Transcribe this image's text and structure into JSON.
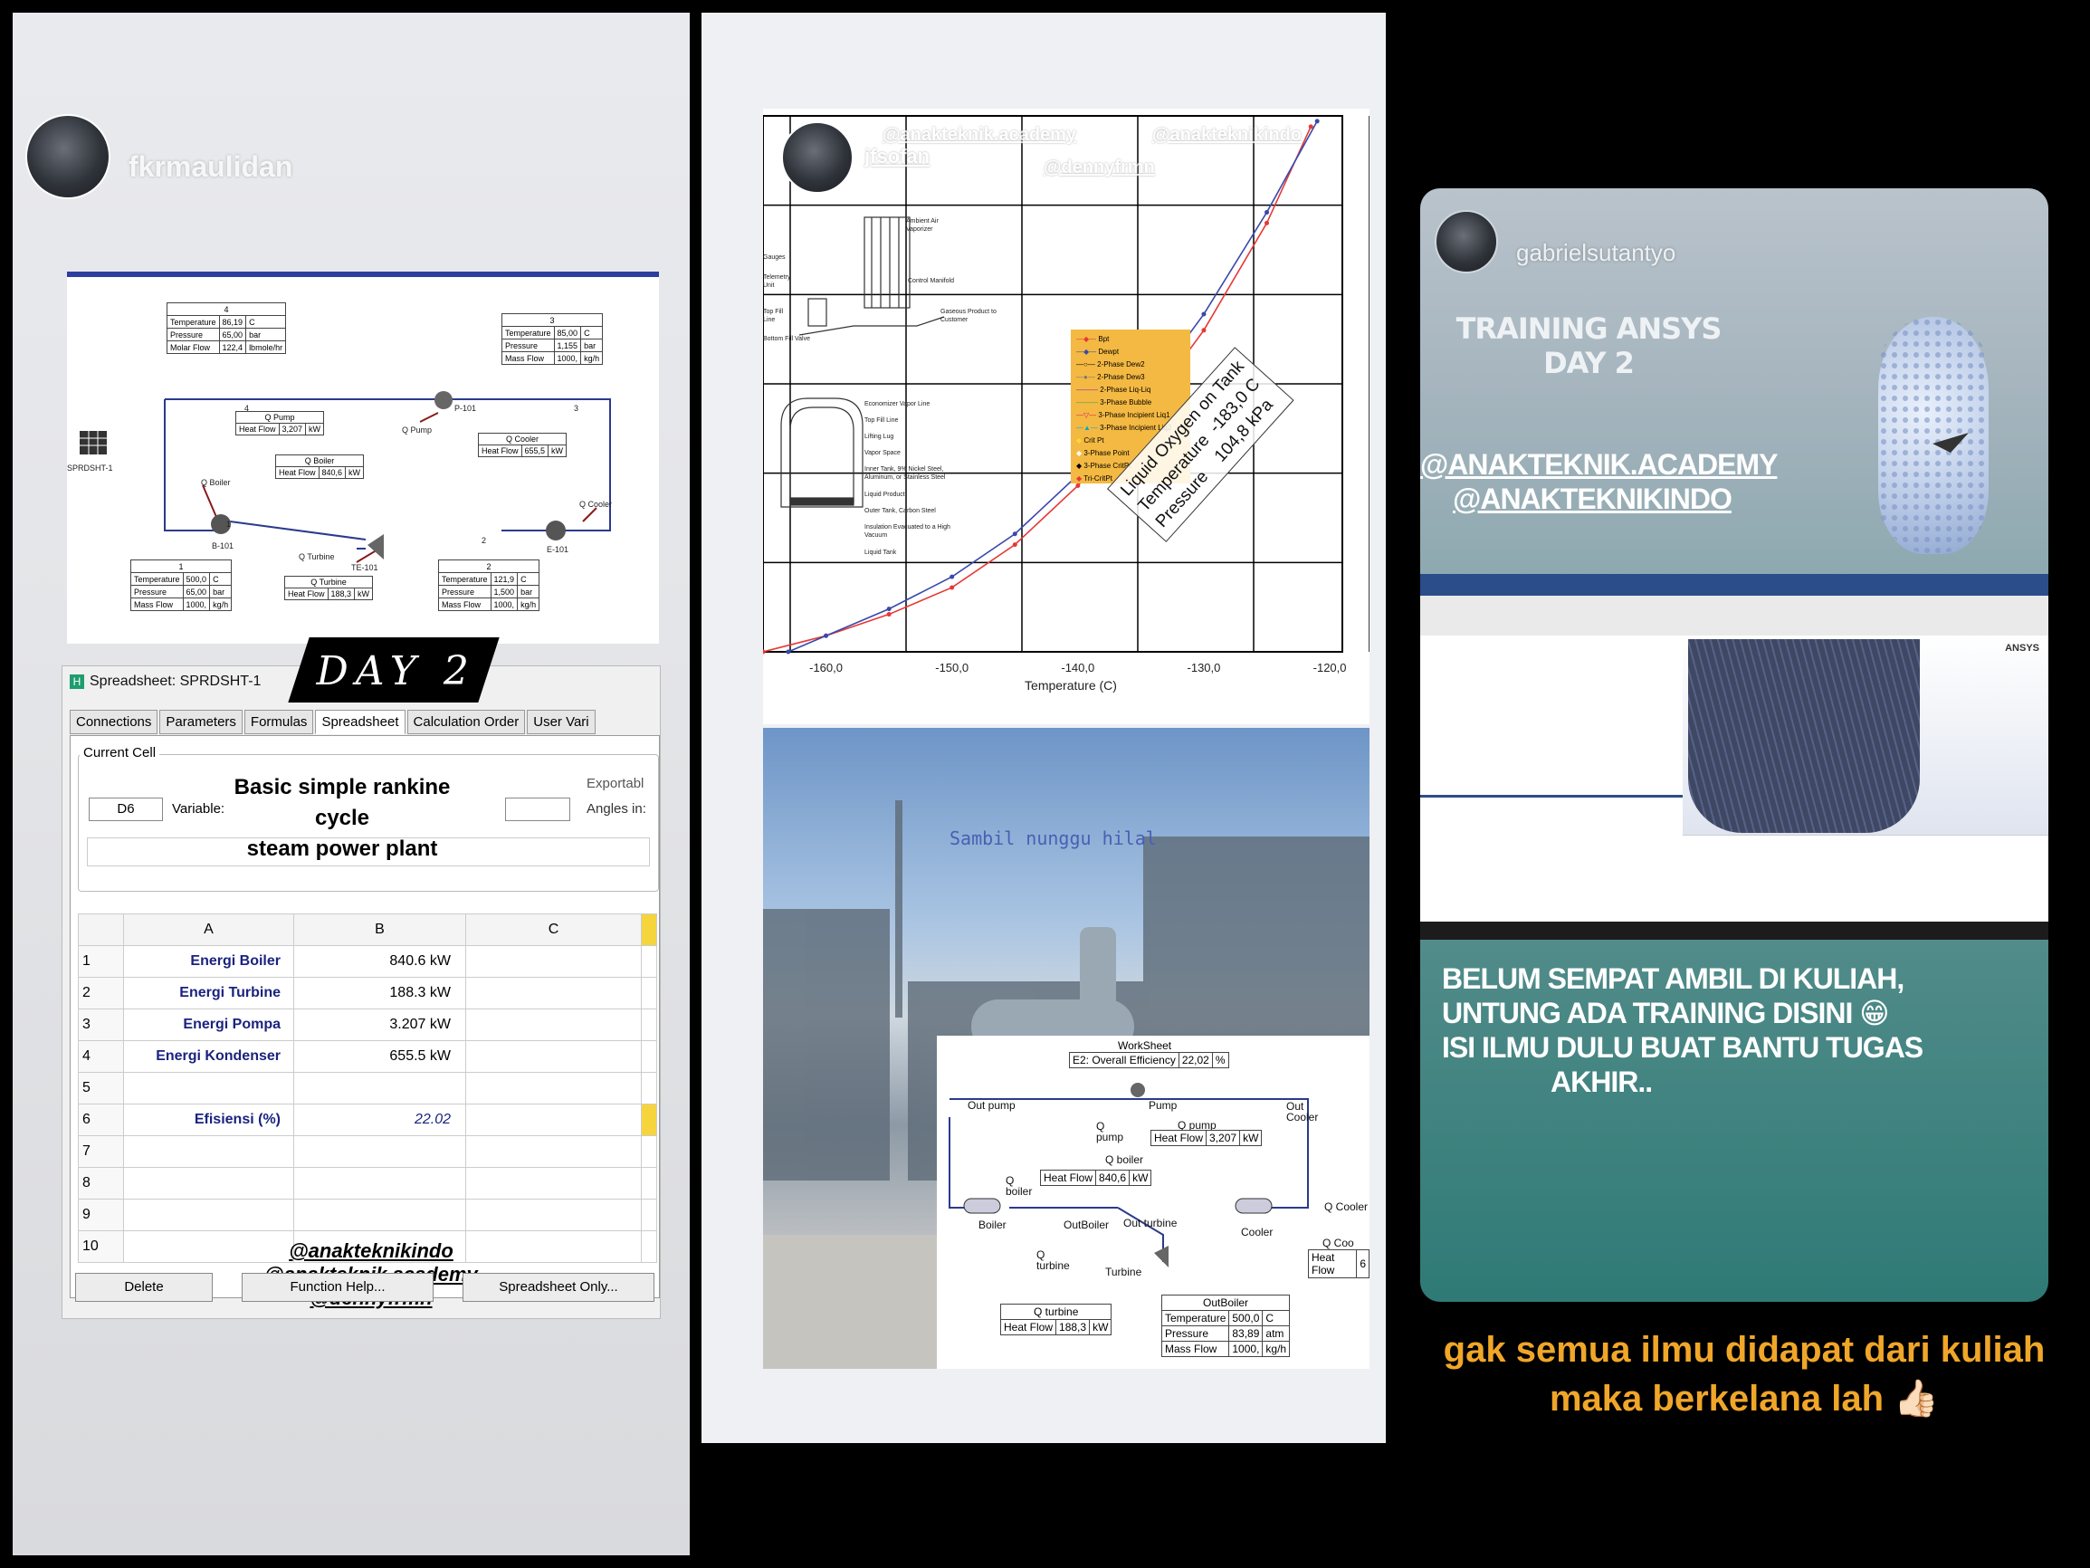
{
  "story1": {
    "username": "fkrmaulidan",
    "diagram": {
      "stream4": {
        "id": "4",
        "rows": [
          [
            "Temperature",
            "86,19",
            "C"
          ],
          [
            "Pressure",
            "65,00",
            "bar"
          ],
          [
            "Molar Flow",
            "122,4",
            "lbmole/hr"
          ]
        ]
      },
      "stream3": {
        "id": "3",
        "rows": [
          [
            "Temperature",
            "85,00",
            "C"
          ],
          [
            "Pressure",
            "1,155",
            "bar"
          ],
          [
            "Mass Flow",
            "1000,",
            "kg/h"
          ]
        ]
      },
      "stream1": {
        "id": "1",
        "rows": [
          [
            "Temperature",
            "500,0",
            "C"
          ],
          [
            "Pressure",
            "65,00",
            "bar"
          ],
          [
            "Mass Flow",
            "1000,",
            "kg/h"
          ]
        ]
      },
      "stream2": {
        "id": "2",
        "rows": [
          [
            "Temperature",
            "121,9",
            "C"
          ],
          [
            "Pressure",
            "1,500",
            "bar"
          ],
          [
            "Mass Flow",
            "1000,",
            "kg/h"
          ]
        ]
      },
      "q_pump": {
        "title": "Q Pump",
        "label": "Heat Flow",
        "value": "3,207",
        "unit": "kW"
      },
      "q_boiler": {
        "title": "Q Boiler",
        "label": "Heat Flow",
        "value": "840,6",
        "unit": "kW"
      },
      "q_cooler": {
        "title": "Q Cooler",
        "label": "Heat Flow",
        "value": "655,5",
        "unit": "kW"
      },
      "q_turbine": {
        "title": "Q Turbine",
        "label": "Heat Flow",
        "value": "188,3",
        "unit": "kW"
      },
      "labels": {
        "spreadsheet": "SPRDSHT-1",
        "pump": "P-101",
        "qpump": "Q Pump",
        "boiler": "B-101",
        "qboiler": "Q Boiler",
        "cooler": "E-101",
        "qcooler": "Q Cooler",
        "turbine": "TE-101",
        "qturbine": "Q Turbine",
        "s1": "1",
        "s2": "2",
        "s3": "3",
        "s4": "4"
      }
    },
    "day_label": "DAY 2",
    "sheet": {
      "title": "Spreadsheet: SPRDSHT-1",
      "tabs": [
        "Connections",
        "Parameters",
        "Formulas",
        "Spreadsheet",
        "Calculation Order",
        "User Vari"
      ],
      "current_cell_label": "Current Cell",
      "cell_value": "D6",
      "variable_label": "Variable:",
      "exportable_label": "Exportabl",
      "angles_label": "Angles in:",
      "headline": [
        "Basic simple rankine cycle",
        "steam power plant"
      ],
      "col_headers": [
        "A",
        "B",
        "C"
      ],
      "rows": [
        {
          "n": "1",
          "a": "Energi Boiler",
          "b": "840.6 kW"
        },
        {
          "n": "2",
          "a": "Energi Turbine",
          "b": "188.3 kW"
        },
        {
          "n": "3",
          "a": "Energi Pompa",
          "b": "3.207 kW"
        },
        {
          "n": "4",
          "a": "Energi Kondenser",
          "b": "655.5 kW"
        },
        {
          "n": "5",
          "a": "",
          "b": ""
        },
        {
          "n": "6",
          "a": "Efisiensi (%)",
          "b": "22.02"
        },
        {
          "n": "7",
          "a": "",
          "b": ""
        },
        {
          "n": "8",
          "a": "",
          "b": ""
        },
        {
          "n": "9",
          "a": "",
          "b": ""
        },
        {
          "n": "10",
          "a": "",
          "b": ""
        }
      ],
      "handles": [
        "@anakteknikindo",
        "@anakteknik.academy",
        "@dennyfrmn"
      ],
      "buttons": {
        "delete": "Delete",
        "function_help": "Function Help...",
        "spreadsheet_only": "Spreadsheet Only..."
      }
    }
  },
  "story2": {
    "username": "jfsofan",
    "handles_top": [
      "@anakteknik.academy",
      "@anakteknikindo",
      "@dennyfrmn"
    ],
    "diagram_labels": [
      "Ambient Air Vaporizer",
      "Control Manifold",
      "Gaseous Product to Customer",
      "Gauges",
      "Telemetry Unit",
      "Top Fill Line",
      "Bottom Fill Valve",
      "Economizer Vapor Line",
      "Top Fill Line",
      "Lifting Lug",
      "Vapor Space",
      "Inner Tank, 9% Nickel Steel, Aluminum, or Stainless Steel",
      "Liquid Product",
      "Outer Tank, Carbon Steel",
      "Insulation Evacuated to a High Vacuum",
      "Liquid Tank"
    ],
    "legend": [
      "Bpt",
      "Dewpt",
      "2-Phase Dew2",
      "2-Phase Dew3",
      "2-Phase Liq-Liq",
      "3-Phase Bubble",
      "3-Phase Incipient Liq1",
      "3-Phase Incipient Liq2",
      "Crit Pt",
      "3-Phase Point",
      "3-Phase CritPt",
      "Tri-CritPt"
    ],
    "legend_colors": [
      "#e53935",
      "#3949ab",
      "#222222",
      "#777777",
      "#8e24aa",
      "#43a047",
      "#d81b60",
      "#00acc1",
      "#fdd835",
      "#ffffff",
      "#000000",
      "#e53935"
    ],
    "annotation": {
      "title": "Liquid Oxygen on Tank",
      "rows": [
        [
          "Temperature",
          "-183,0",
          "C"
        ],
        [
          "Pressure",
          "104,8",
          "kPa"
        ]
      ]
    },
    "chart_data": {
      "type": "line",
      "xlabel": "Temperature (C)",
      "x_ticks": [
        "-160,0",
        "-150,0",
        "-140,0",
        "-130,0",
        "-120,0"
      ],
      "xlim": [
        -165,
        -119
      ],
      "ylim": [
        0,
        1
      ],
      "series": [
        {
          "name": "Bpt",
          "color": "#e53935",
          "x": [
            -165,
            -160,
            -155,
            -150,
            -145,
            -140,
            -135,
            -130,
            -125,
            -121.5
          ],
          "y": [
            0.0,
            0.03,
            0.07,
            0.12,
            0.2,
            0.31,
            0.44,
            0.6,
            0.8,
            0.98
          ]
        },
        {
          "name": "Dewpt",
          "color": "#3949ab",
          "x": [
            -163,
            -160,
            -155,
            -150,
            -145,
            -140,
            -135,
            -130,
            -125,
            -121
          ],
          "y": [
            0.0,
            0.03,
            0.08,
            0.14,
            0.22,
            0.33,
            0.47,
            0.63,
            0.82,
            0.99
          ]
        }
      ]
    },
    "overlay_text": "Sambil nunggu hilal",
    "worksheet": {
      "title": "WorkSheet",
      "efficiency_label": "E2: Overall Efficiency",
      "efficiency_value": "22,02",
      "efficiency_unit": "%",
      "labels": [
        "Out pump",
        "Pump",
        "Out Cooler",
        "Q pump",
        "Q pump",
        "Q boiler",
        "Q boiler",
        "Boiler",
        "OutBoiler",
        "Out turbine",
        "Cooler",
        "Q Cooler",
        "Q turbine",
        "Turbine",
        "Q Coo"
      ],
      "q_pump": {
        "label": "Heat Flow",
        "value": "3,207",
        "unit": "kW"
      },
      "q_boiler": {
        "label": "Heat Flow",
        "value": "840,6",
        "unit": "kW"
      },
      "q_turbine": {
        "label": "Heat Flow",
        "value": "188,3",
        "unit": "kW"
      },
      "q_cooler": {
        "label": "Heat Flow",
        "value": "6"
      },
      "outboiler": {
        "title": "OutBoiler",
        "rows": [
          [
            "Temperature",
            "500,0",
            "C"
          ],
          [
            "Pressure",
            "83,89",
            "atm"
          ],
          [
            "Mass Flow",
            "1000,",
            "kg/h"
          ]
        ]
      }
    }
  },
  "story3": {
    "username": "gabrielsutantyo",
    "training": [
      "TRAINING ANSYS",
      "DAY 2"
    ],
    "handles": [
      "@ANAKTEKNIK.ACADEMY",
      "@ANAKTEKNIKINDO"
    ],
    "ansys_label": "ANSYS",
    "message": [
      "BELUM SEMPAT AMBIL DI KULIAH,",
      "UNTUNG ADA TRAINING DISINI 😁",
      "ISI ILMU DULU BUAT BANTU TUGAS",
      "AKHIR.."
    ],
    "caption": [
      "gak semua ilmu didapat dari kuliah",
      "maka berkelana lah 👍🏻"
    ]
  }
}
